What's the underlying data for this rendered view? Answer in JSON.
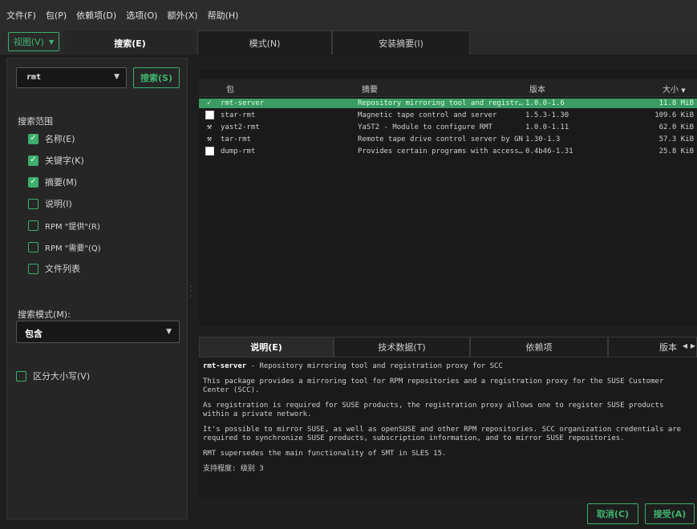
{
  "menubar": {
    "items": [
      "文件(F)",
      "包(P)",
      "依赖项(D)",
      "选项(O)",
      "额外(X)",
      "帮助(H)"
    ]
  },
  "toolbar": {
    "view_label": "视图(V)",
    "tabs": [
      {
        "label": "搜索(E)",
        "active": true
      },
      {
        "label": "模式(N)",
        "active": false
      },
      {
        "label": "安装摘要(I)",
        "active": false
      }
    ]
  },
  "search": {
    "query": "rmt",
    "button_label": "搜索(S)",
    "scope_title": "搜索范围",
    "scope": [
      {
        "label": "名称(E)",
        "checked": true
      },
      {
        "label": "关键字(K)",
        "checked": true
      },
      {
        "label": "摘要(M)",
        "checked": true
      },
      {
        "label": "说明(I)",
        "checked": false
      },
      {
        "label": "RPM \"提供\"(R)",
        "checked": false
      },
      {
        "label": "RPM \"需要\"(Q)",
        "checked": false
      },
      {
        "label": "文件列表",
        "checked": false
      }
    ],
    "mode_label": "搜索模式(M):",
    "mode_value": "包含",
    "case_sensitive_label": "区分大小写(V)"
  },
  "packages": {
    "columns": [
      "包",
      "摘要",
      "版本",
      "大小"
    ],
    "rows": [
      {
        "status": "installed",
        "name": "rmt-server",
        "summary": "Repository mirroring tool and registr…",
        "version": "1.0.0-1.6",
        "size": "11.8 MiB",
        "selected": true
      },
      {
        "status": "not-installed",
        "name": "star-rmt",
        "summary": "Magnetic tape control and server",
        "version": "1.5.3-1.30",
        "size": "109.6 KiB",
        "selected": false
      },
      {
        "status": "protected",
        "name": "yast2-rmt",
        "summary": "YaST2 - Module to configure RMT",
        "version": "1.0.0-1.11",
        "size": "62.0 KiB",
        "selected": false
      },
      {
        "status": "protected",
        "name": "tar-rmt",
        "summary": "Remote tape drive control server by GNU",
        "version": "1.30-1.3",
        "size": "57.3 KiB",
        "selected": false
      },
      {
        "status": "not-installed",
        "name": "dump-rmt",
        "summary": "Provides certain programs with access…",
        "version": "0.4b46-1.31",
        "size": "25.8 KiB",
        "selected": false
      }
    ]
  },
  "details": {
    "tabs": [
      {
        "label": "说明(E)",
        "active": true
      },
      {
        "label": "技术数据(T)",
        "active": false
      },
      {
        "label": "依赖项",
        "active": false
      },
      {
        "label": "版本",
        "active": false
      }
    ],
    "pkg_name": "rmt-server",
    "pkg_summary": " - Repository mirroring tool and registration proxy for SCC",
    "paragraphs": [
      "This package provides a mirroring tool for RPM repositories and a registration proxy for the SUSE Customer Center (SCC).",
      "As registration is required for SUSE products, the registration proxy allows one to register SUSE products within a private network.",
      "It's possible to mirror SUSE, as well as openSUSE and other RPM repositories. SCC organization credentials are required to synchronize SUSE products, subscription information, and to mirror SUSE repositories.",
      "RMT supersedes the main functionality of SMT in SLES 15."
    ],
    "support_level": "支持程度: 级别 3"
  },
  "actions": {
    "cancel_label": "取消(C)",
    "accept_label": "接受(A)"
  },
  "colors": {
    "accent": "#3daf6d",
    "selected_row": "#3a9b63",
    "background": "#1e1e1e"
  }
}
